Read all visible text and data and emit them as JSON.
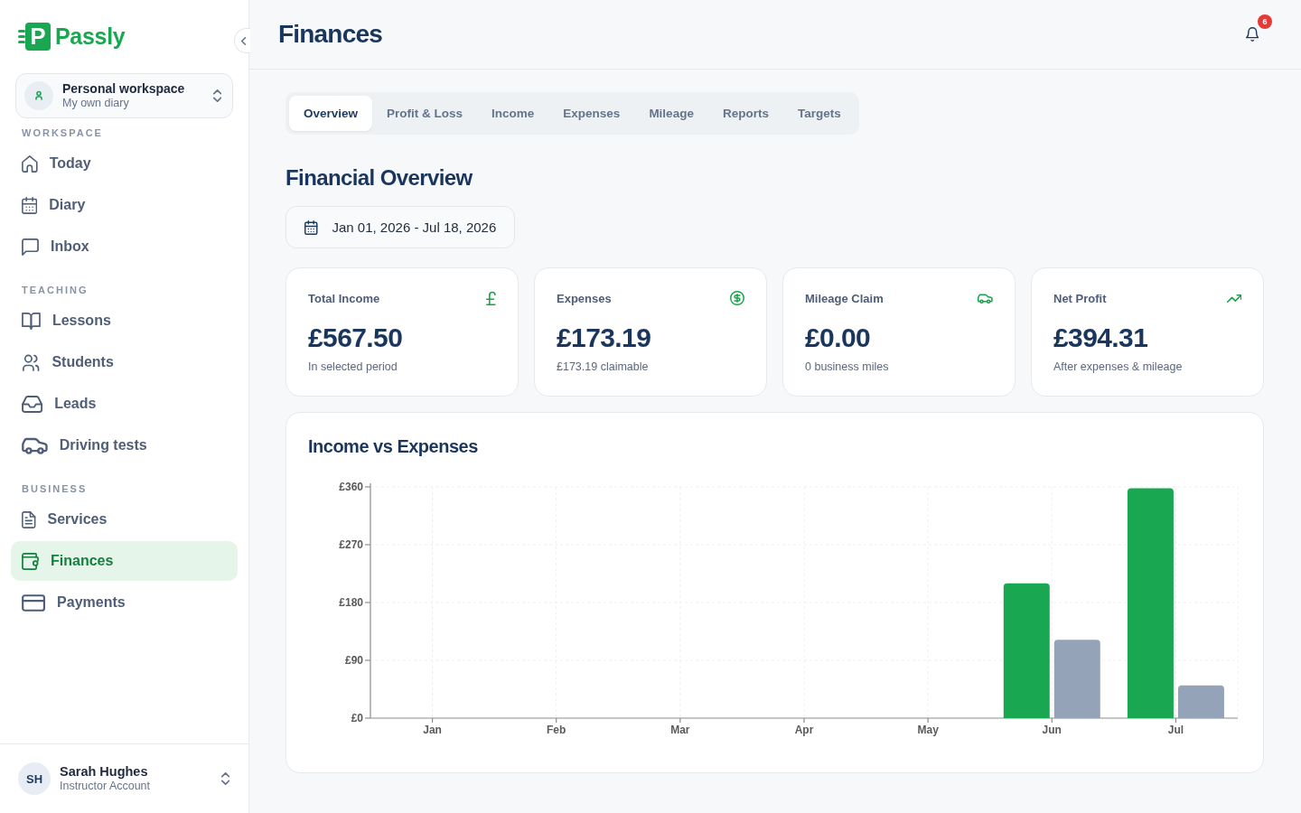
{
  "sidebar": {
    "logo": {
      "mark": "P",
      "name": "Passly"
    },
    "workspace_switcher": {
      "title": "Personal workspace",
      "subtitle": "My own diary"
    },
    "sections": [
      {
        "heading": "WORKSPACE",
        "items": [
          {
            "label": "Today",
            "selected": false
          },
          {
            "label": "Diary",
            "selected": false
          },
          {
            "label": "Inbox",
            "selected": false
          }
        ]
      },
      {
        "heading": "TEACHING",
        "items": [
          {
            "label": "Lessons",
            "selected": false
          },
          {
            "label": "Students",
            "selected": false
          },
          {
            "label": "Leads",
            "selected": false
          },
          {
            "label": "Driving tests",
            "selected": false
          }
        ]
      },
      {
        "heading": "BUSINESS",
        "items": [
          {
            "label": "Services",
            "selected": false
          },
          {
            "label": "Finances",
            "selected": true
          },
          {
            "label": "Payments",
            "selected": false
          }
        ]
      }
    ],
    "user": {
      "initials": "SH",
      "name": "Sarah Hughes",
      "role": "Instructor Account"
    }
  },
  "header": {
    "title": "Finances",
    "notifications": {
      "count": "6"
    }
  },
  "tabs": [
    {
      "label": "Overview",
      "selected": true
    },
    {
      "label": "Profit & Loss",
      "selected": false
    },
    {
      "label": "Income",
      "selected": false
    },
    {
      "label": "Expenses",
      "selected": false
    },
    {
      "label": "Mileage",
      "selected": false
    },
    {
      "label": "Reports",
      "selected": false
    },
    {
      "label": "Targets",
      "selected": false
    }
  ],
  "section_title": "Financial Overview",
  "date_range": "Jan 01, 2026 - Jul 18, 2026",
  "stat_cards": [
    {
      "label": "Total Income",
      "value": "£567.50",
      "note": "In selected period"
    },
    {
      "label": "Expenses",
      "value": "£173.19",
      "note": "£173.19 claimable"
    },
    {
      "label": "Mileage Claim",
      "value": "£0.00",
      "note": "0 business miles"
    },
    {
      "label": "Net Profit",
      "value": "£394.31",
      "note": "After expenses & mileage"
    }
  ],
  "chart_card": {
    "title": "Income vs Expenses",
    "chart_data": {
      "type": "bar",
      "categories": [
        "Jan",
        "Feb",
        "Mar",
        "Apr",
        "May",
        "Jun",
        "Jul"
      ],
      "series": [
        {
          "color": "#1aa751",
          "values": [
            0,
            0,
            0,
            0,
            0,
            210,
            358
          ]
        },
        {
          "color": "#94a3b8",
          "values": [
            0,
            0,
            0,
            0,
            0,
            122,
            51
          ]
        }
      ],
      "ylim": [
        0,
        360
      ],
      "yticks": [
        {
          "value": 0,
          "label": "£0"
        },
        {
          "value": 90,
          "label": "£90"
        },
        {
          "value": 180,
          "label": "£180"
        },
        {
          "value": 270,
          "label": "£270"
        },
        {
          "value": 360,
          "label": "£360"
        }
      ],
      "grid": true
    }
  }
}
